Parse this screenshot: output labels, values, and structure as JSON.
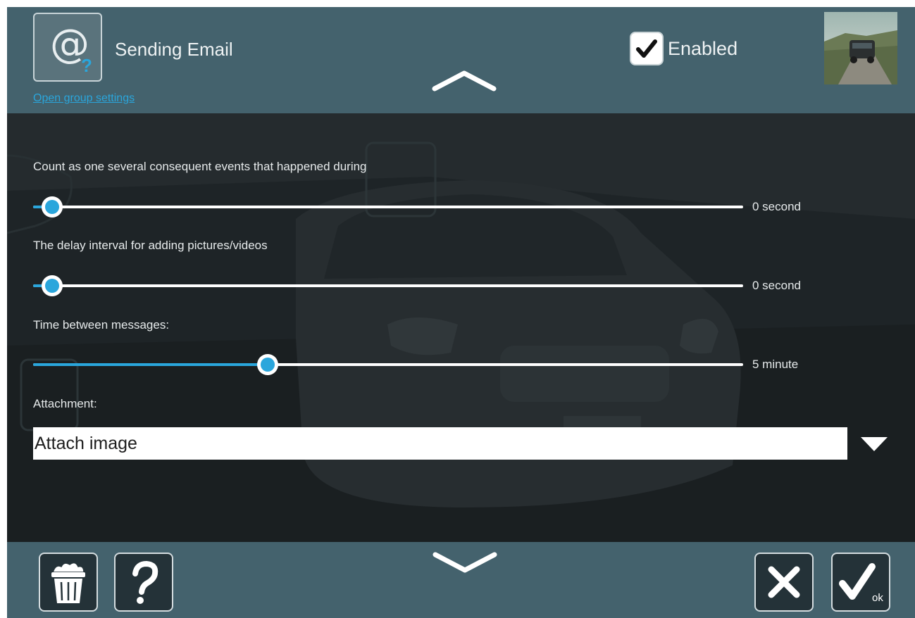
{
  "header": {
    "title": "Sending Email",
    "group_settings_link": "Open group settings",
    "enabled_label": "Enabled",
    "enabled_checked": true
  },
  "settings": {
    "merge_events": {
      "label": "Count as one several consequent events that happened during",
      "value_text": "0 second",
      "fraction": 0.027
    },
    "delay_interval": {
      "label": "The delay interval for adding pictures/videos",
      "value_text": "0 second",
      "fraction": 0.027
    },
    "time_between": {
      "label": "Time between messages:",
      "value_text": "5 minute",
      "fraction": 0.33
    },
    "attachment": {
      "label": "Attachment:",
      "selected": "Attach image"
    }
  },
  "footer": {
    "ok_badge": "ok"
  },
  "colors": {
    "accent": "#2aa6dc",
    "header_bg": "#44626d",
    "main_bg": "#1c2124"
  }
}
